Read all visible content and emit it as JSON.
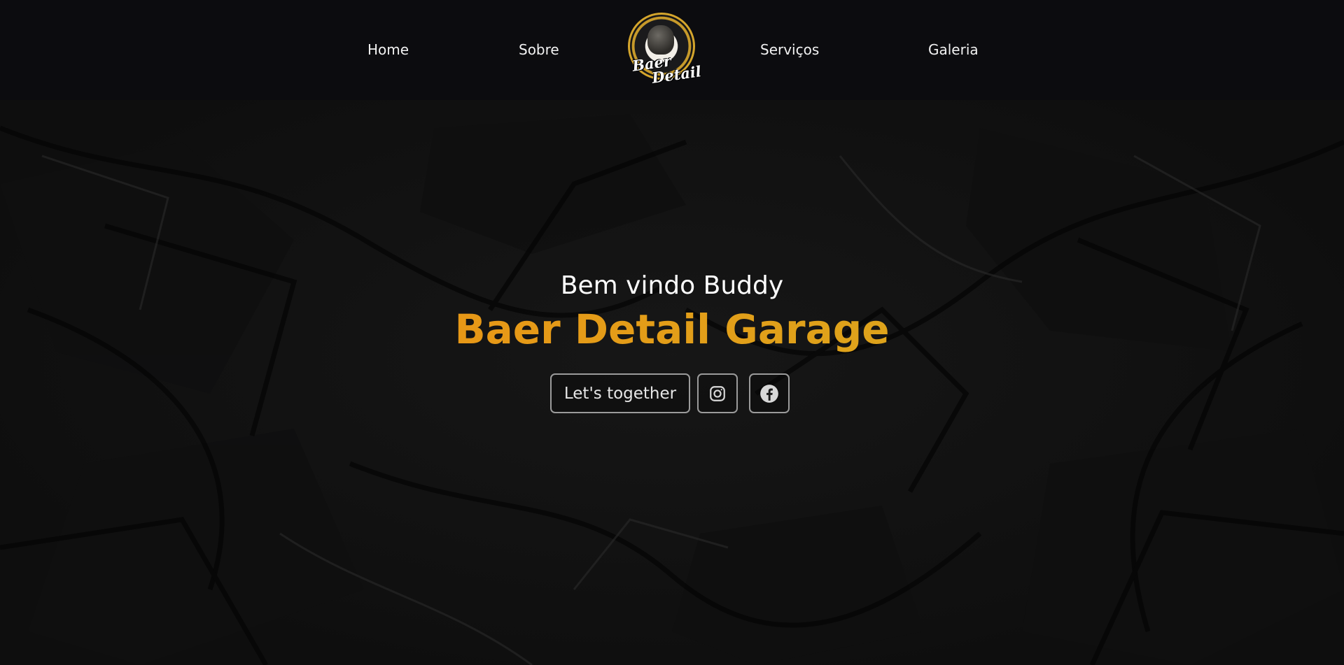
{
  "nav": {
    "items": [
      {
        "label": "Home"
      },
      {
        "label": "Sobre"
      },
      {
        "label": "Serviços"
      },
      {
        "label": "Galeria"
      }
    ],
    "logo": {
      "line1": "Baer",
      "line2": "Detail"
    }
  },
  "hero": {
    "greeting": "Bem vindo Buddy",
    "title": "Baer Detail Garage",
    "cta_label": "Let's together",
    "social": [
      {
        "icon": "instagram-icon"
      },
      {
        "icon": "facebook-icon"
      }
    ]
  },
  "colors": {
    "background": "#0c0c0f",
    "title_gradient_start": "#f08c12",
    "title_gradient_end": "#d4ad22",
    "button_border": "#9b9b9b"
  }
}
